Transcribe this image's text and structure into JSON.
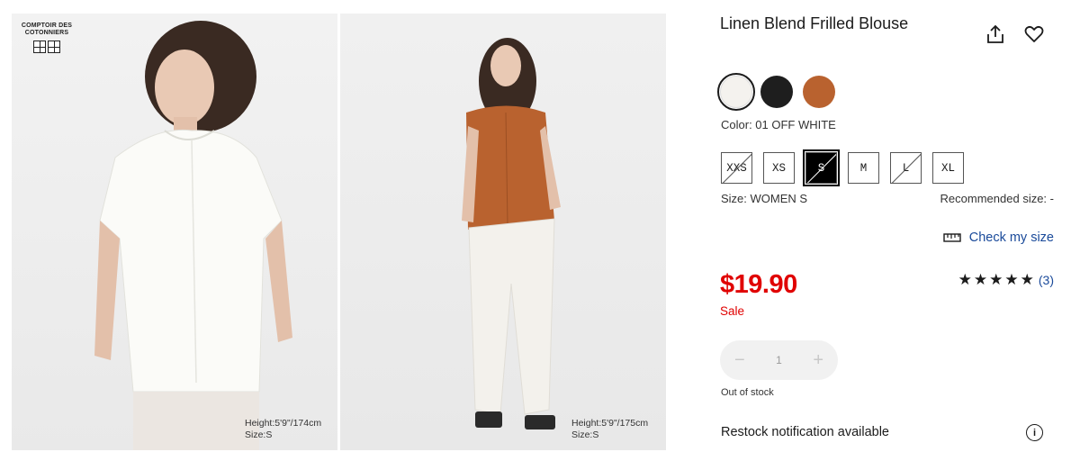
{
  "gallery": {
    "photos": [
      {
        "caption_line1": "Height:5'9\"/174cm",
        "caption_line2": "Size:S"
      },
      {
        "caption_line1": "Height:5'9\"/175cm",
        "caption_line2": "Size:S"
      }
    ],
    "brand": {
      "line1": "COMPTOIR DES",
      "line2": "COTONNIERS"
    }
  },
  "product": {
    "title": "Linen Blend Frilled Blouse",
    "color_label": "Color: 01 OFF WHITE",
    "swatches": [
      {
        "name": "Off White",
        "color": "#f4f2ee",
        "selected": true
      },
      {
        "name": "Black",
        "color": "#1e1e1e",
        "selected": false
      },
      {
        "name": "Brown",
        "color": "#b9622f",
        "selected": false
      }
    ],
    "sizes": [
      {
        "label": "XXS",
        "out_of_stock": true,
        "selected": false
      },
      {
        "label": "XS",
        "out_of_stock": false,
        "selected": false
      },
      {
        "label": "S",
        "out_of_stock": true,
        "selected": true
      },
      {
        "label": "M",
        "out_of_stock": false,
        "selected": false
      },
      {
        "label": "L",
        "out_of_stock": true,
        "selected": false
      },
      {
        "label": "XL",
        "out_of_stock": false,
        "selected": false
      }
    ],
    "size_label": "Size: WOMEN S",
    "recommended_size": "Recommended size: -",
    "check_size_label": "Check my size",
    "price": "$19.90",
    "sale_label": "Sale",
    "rating": {
      "stars": "★★★★★",
      "count": "(3)"
    },
    "quantity": {
      "minus": "−",
      "value": "1",
      "plus": "+"
    },
    "stock_status": "Out of stock",
    "restock_label": "Restock notification available",
    "info_icon": "i"
  },
  "colors": {
    "price_red": "#e00000",
    "link_blue": "#1a4a9a"
  },
  "icons": {
    "share": "share-icon",
    "favorite": "heart-icon",
    "ruler": "ruler-icon",
    "info": "info-icon"
  }
}
